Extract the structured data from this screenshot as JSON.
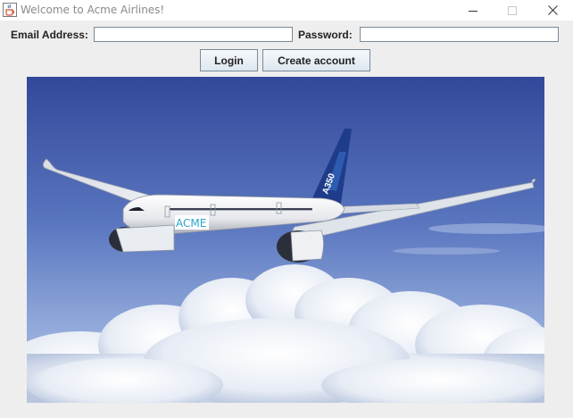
{
  "window": {
    "title": "Welcome to Acme Airlines!",
    "controls": {
      "minimize": "minimize-icon",
      "maximize": "maximize-icon",
      "close": "close-icon"
    }
  },
  "form": {
    "email_label": "Email Address:",
    "email_value": "",
    "password_label": "Password:",
    "password_value": ""
  },
  "buttons": {
    "login_label": "Login",
    "create_account_label": "Create account"
  },
  "hero": {
    "livery_text": "ACME",
    "tail_text": "A350",
    "colors": {
      "sky_top": "#3a4f9e",
      "sky_bottom": "#8fa8d8",
      "fuselage": "#f4f5f7",
      "tail": "#1f3c8a",
      "livery_text": "#2aa6c8"
    }
  }
}
